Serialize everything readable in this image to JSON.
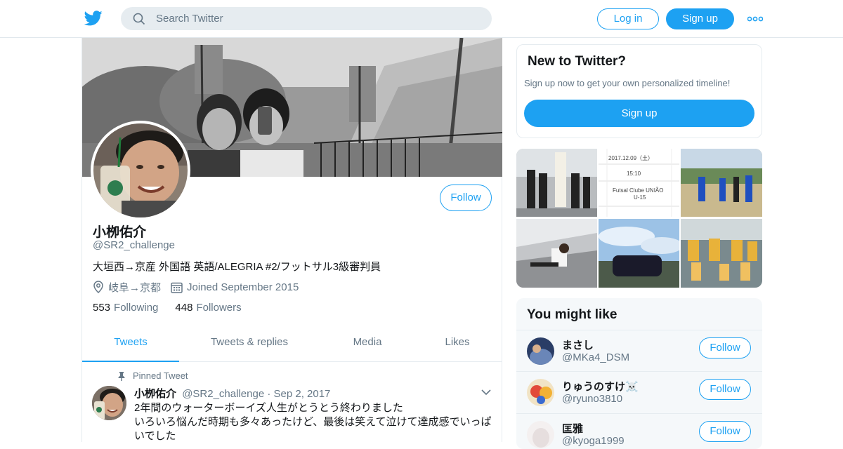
{
  "topbar": {
    "search_placeholder": "Search Twitter",
    "login_label": "Log in",
    "signup_label": "Sign up",
    "brand_color": "#1da1f2"
  },
  "profile": {
    "follow_label": "Follow",
    "name": "小栁佑介",
    "handle": "@SR2_challenge",
    "bio": "大垣西→京産 外国語 英語/ALEGRIA #2/フットサル3級審判員",
    "location": "岐阜→京都",
    "joined": "Joined September 2015",
    "following_count": "553",
    "following_label": "Following",
    "followers_count": "448",
    "followers_label": "Followers"
  },
  "tabs": [
    {
      "label": "Tweets",
      "active": true
    },
    {
      "label": "Tweets & replies",
      "active": false
    },
    {
      "label": "Media",
      "active": false
    },
    {
      "label": "Likes",
      "active": false
    }
  ],
  "tweet": {
    "pinned_label": "Pinned Tweet",
    "name": "小栁佑介",
    "handle": "@SR2_challenge",
    "separator": "·",
    "date": "Sep 2, 2017",
    "text_line1": "2年間のウォーターボーイズ人生がとうとう終わりました",
    "text_line2": "いろいろ悩んだ時期も多々あったけど、最後は笑えて泣けて達成感でいっぱいでした"
  },
  "new_to_twitter": {
    "title": "New to Twitter?",
    "subtitle": "Sign up now to get your own personalized timeline!",
    "signup_label": "Sign up"
  },
  "media": {
    "tile2_date": "2017.12.09（土）",
    "tile2_time": "15:10",
    "tile2_team": "Futsal Clube UNIÃO",
    "tile2_team2": "U-15"
  },
  "you_might_like": {
    "title": "You might like",
    "users": [
      {
        "name": "まさし",
        "handle": "@MKa4_DSM",
        "follow_label": "Follow"
      },
      {
        "name": "りゅうのすけ☠️",
        "handle": "@ryuno3810",
        "follow_label": "Follow"
      },
      {
        "name": "匡雅",
        "handle": "@kyoga1999",
        "follow_label": "Follow"
      }
    ]
  }
}
